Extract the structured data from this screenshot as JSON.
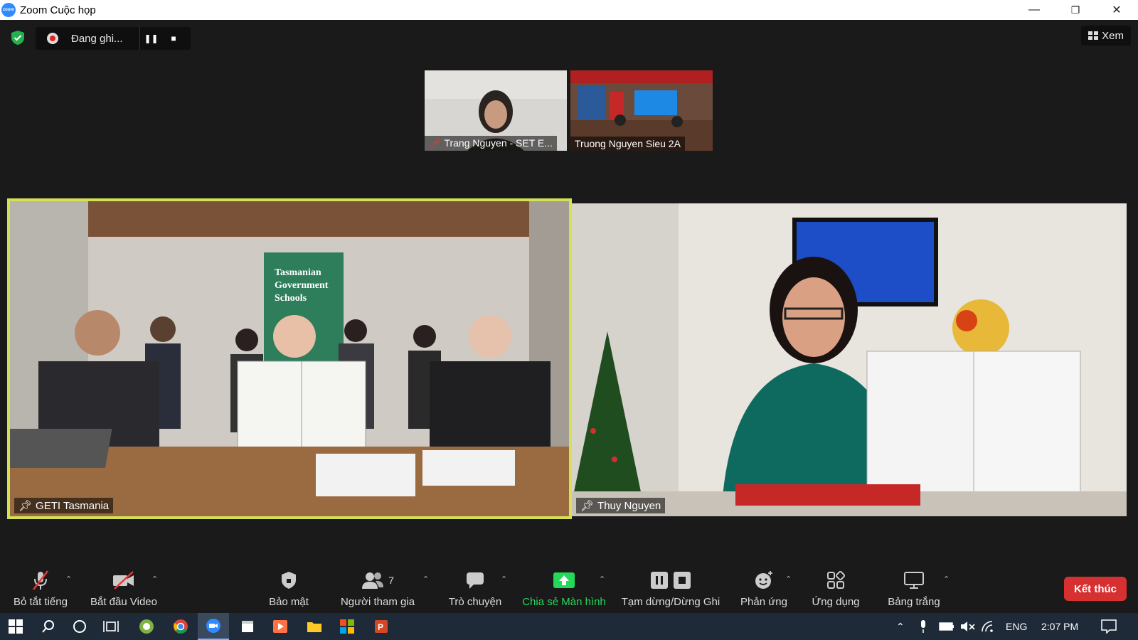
{
  "window": {
    "title": "Zoom Cuộc họp",
    "logo_text": "zoom",
    "minimize": "—",
    "restore": "❐",
    "close": "✕"
  },
  "recording": {
    "status": "Đang ghi...",
    "pause": "❚❚",
    "stop": "■"
  },
  "view_button": {
    "label": "Xem"
  },
  "thumbnails": [
    {
      "name": "Trang Nguyen - SET E...",
      "muted": true
    },
    {
      "name": "Truong Nguyen Sieu 2A",
      "muted": false
    }
  ],
  "videos": [
    {
      "name": "GETI Tasmania",
      "active": true,
      "banner": "Tasmanian Government Schools"
    },
    {
      "name": "Thuy Nguyen",
      "active": false
    }
  ],
  "toolbar": {
    "mute": "Bỏ tắt tiếng",
    "video": "Bắt đầu Video",
    "security": "Bảo mật",
    "participants": "Người tham gia",
    "participants_count": "7",
    "chat": "Trò chuyện",
    "share": "Chia sẻ Màn hình",
    "record": "Tạm dừng/Dừng Ghi",
    "reactions": "Phản ứng",
    "apps": "Ứng dụng",
    "whiteboard": "Bảng trắng",
    "end": "Kết thúc"
  },
  "taskbar": {
    "language": "ENG",
    "time": "2:07 PM"
  },
  "colors": {
    "active_speaker": "#d4e157",
    "share_green": "#23d959",
    "end_red": "#d63030",
    "zoom_blue": "#2d8cff"
  }
}
